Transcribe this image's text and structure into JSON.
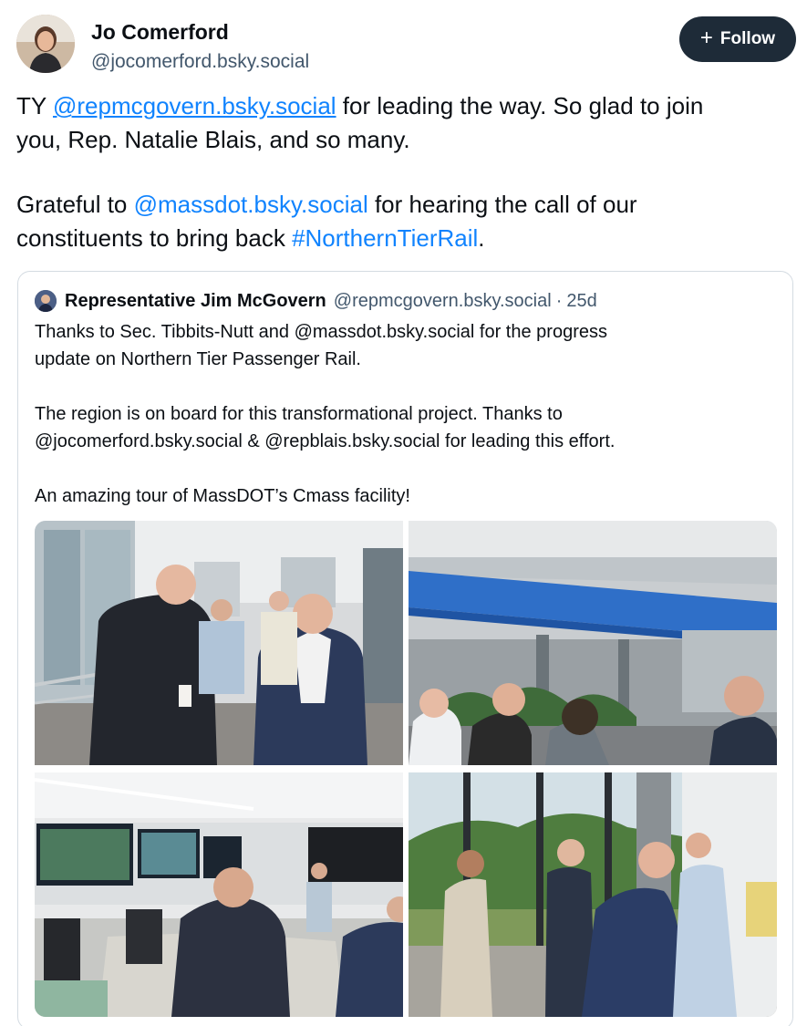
{
  "post": {
    "author": {
      "name": "Jo Comerford",
      "handle": "@jocomerford.bsky.social"
    },
    "follow": {
      "icon": "plus-icon",
      "label": "Follow"
    },
    "text": {
      "p1_a": "TY ",
      "p1_mention": "@repmcgovern.bsky.social",
      "p1_b": " for leading the way. So glad to join",
      "p1_line2": "you, Rep. Natalie Blais, and so many.",
      "p2_a": "Grateful to ",
      "p2_mention": "@massdot.bsky.social",
      "p2_b": " for hearing the call of our",
      "p2_c": "constituents to bring back ",
      "p2_hashtag": "#NorthernTierRail",
      "p2_d": "."
    }
  },
  "quote": {
    "author": {
      "name": "Representative Jim McGovern",
      "handle": "@repmcgovern.bsky.social",
      "separator": "·",
      "age": "25d"
    },
    "lines": [
      "Thanks to Sec. Tibbits-Nutt and @massdot.bsky.social for the progress",
      "update on Northern Tier Passenger Rail.",
      "The region is on board for this transformational project. Thanks to",
      "@jocomerford.bsky.social & @repblais.bsky.social for leading this effort.",
      "An amazing tour of MassDOT’s Cmass facility!"
    ],
    "images": [
      "group-walking-hallway-photo",
      "lobby-atrium-photo",
      "control-room-photo",
      "glass-walled-room-photo"
    ]
  },
  "colors": {
    "link": "#1083fe",
    "follow_bg": "#1e2b38",
    "muted_text": "#42576c",
    "border": "#d4dbe2"
  }
}
